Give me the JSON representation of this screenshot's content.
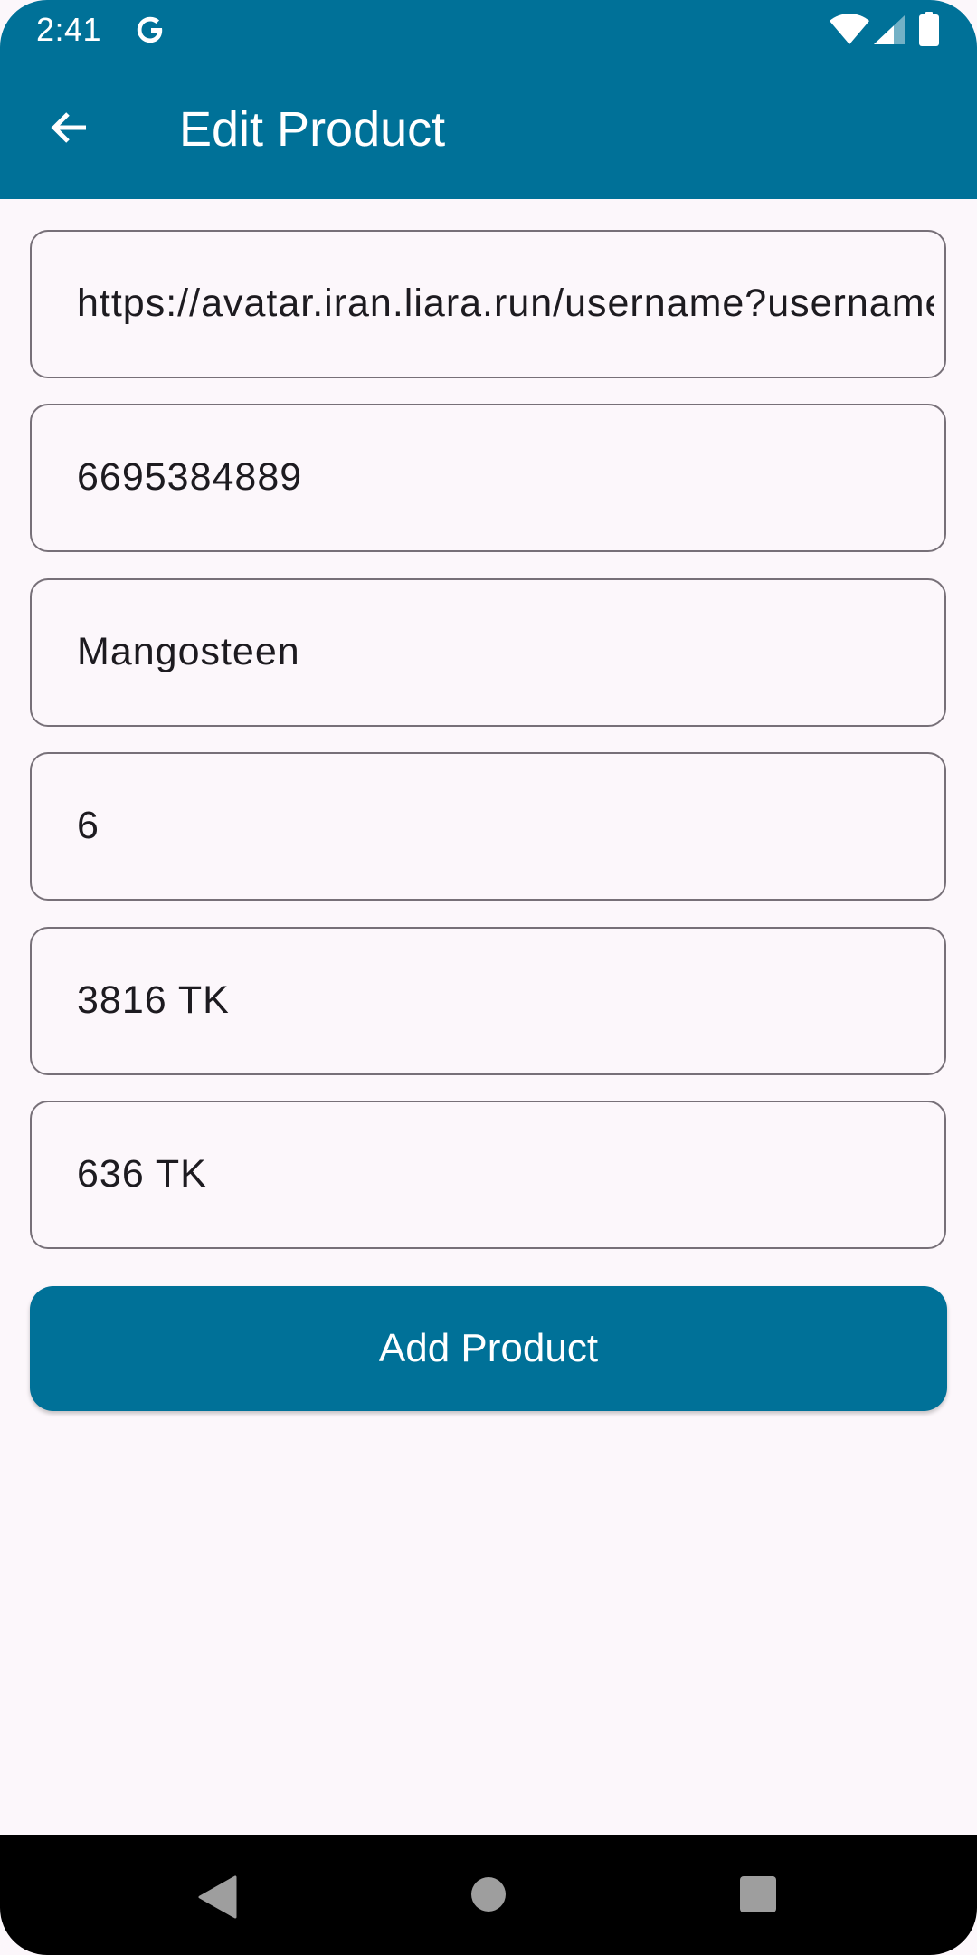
{
  "status_bar": {
    "time": "2:41",
    "icons": [
      "google-icon",
      "wifi-icon",
      "signal-icon",
      "battery-icon"
    ]
  },
  "app_bar": {
    "back_icon": "arrow-back-icon",
    "title": "Edit Product"
  },
  "form": {
    "fields": [
      {
        "name": "image-url",
        "value": "https://avatar.iran.liara.run/username?username="
      },
      {
        "name": "product-id",
        "value": "6695384889"
      },
      {
        "name": "product-name",
        "value": "Mangosteen"
      },
      {
        "name": "quantity",
        "value": "6"
      },
      {
        "name": "price",
        "value": "3816 TK"
      },
      {
        "name": "discount",
        "value": "636 TK"
      }
    ],
    "submit_label": "Add Product"
  },
  "nav_bar": {
    "icons": [
      "nav-back-icon",
      "nav-home-icon",
      "nav-recents-icon"
    ]
  },
  "colors": {
    "primary": "#007198",
    "background": "#FCF7FB",
    "outline": "#777078",
    "text": "#1D1B20"
  }
}
